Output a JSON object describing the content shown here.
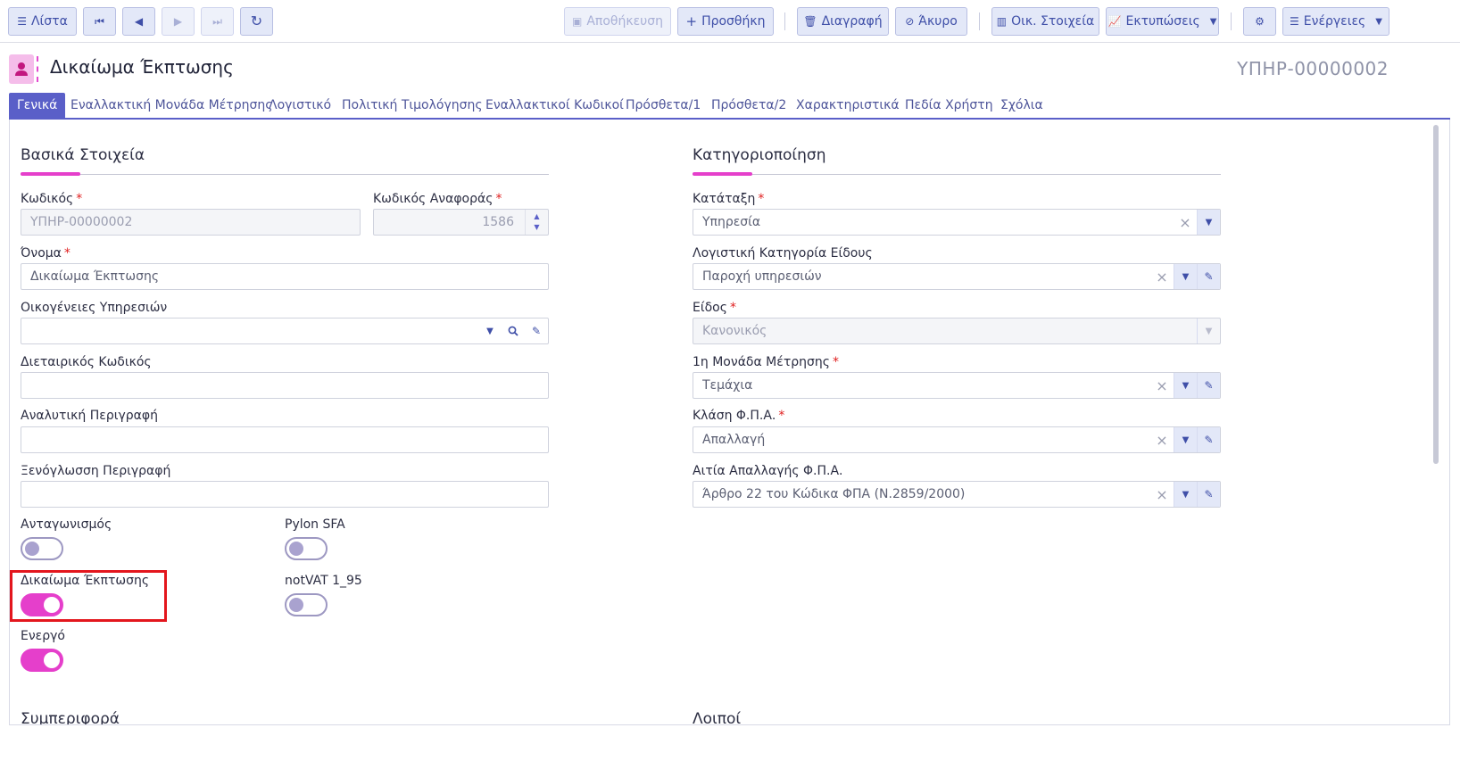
{
  "toolbar": {
    "list_label": "Λίστα",
    "save_label": "Αποθήκευση",
    "add_label": "Προσθήκη",
    "delete_label": "Διαγραφή",
    "cancel_label": "Άκυρο",
    "financial_label": "Οικ. Στοιχεία",
    "prints_label": "Εκτυπώσεις",
    "actions_label": "Ενέργειες"
  },
  "header": {
    "title": "Δικαίωμα Έκπτωσης",
    "record_code": "ΥΠΗΡ-00000002"
  },
  "tabs": [
    {
      "label": "Γενικά",
      "active": true
    },
    {
      "label": "Εναλλακτική Μονάδα Μέτρησης"
    },
    {
      "label": "Λογιστικό"
    },
    {
      "label": "Πολιτική Τιμολόγησης"
    },
    {
      "label": "Εναλλακτικοί Κωδικοί"
    },
    {
      "label": "Πρόσθετα/1"
    },
    {
      "label": "Πρόσθετα/2"
    },
    {
      "label": "Χαρακτηριστικά"
    },
    {
      "label": "Πεδία Χρήστη"
    },
    {
      "label": "Σχόλια"
    }
  ],
  "basic": {
    "section_title": "Βασικά Στοιχεία",
    "code_label": "Κωδικός",
    "code_value": "ΥΠΗΡ-00000002",
    "ref_code_label": "Κωδικός Αναφοράς",
    "ref_code_value": "1586",
    "name_label": "Όνομα",
    "name_value": "Δικαίωμα Έκπτωσης",
    "families_label": "Οικογένειες Υπηρεσιών",
    "families_value": "",
    "intercompany_label": "Διεταιρικός Κωδικός",
    "intercompany_value": "",
    "detailed_desc_label": "Αναλυτική Περιγραφή",
    "detailed_desc_value": "",
    "foreign_desc_label": "Ξενόγλωσση Περιγραφή",
    "foreign_desc_value": ""
  },
  "toggles": {
    "competition_label": "Ανταγωνισμός",
    "competition_on": false,
    "pylon_label": "Pylon SFA",
    "pylon_on": false,
    "discount_label": "Δικαίωμα Έκπτωσης",
    "discount_on": true,
    "notvat_label": "notVAT 1_95",
    "notvat_on": false,
    "active_label": "Ενεργό",
    "active_on": true
  },
  "classification": {
    "section_title": "Κατηγοριοποίηση",
    "category_label": "Κατάταξη",
    "category_value": "Υπηρεσία",
    "accounting_cat_label": "Λογιστική Κατηγορία Είδους",
    "accounting_cat_value": "Παροχή υπηρεσιών",
    "kind_label": "Είδος",
    "kind_value": "Κανονικός",
    "uom_label": "1η Μονάδα Μέτρησης",
    "uom_value": "Τεμάχια",
    "vat_class_label": "Κλάση Φ.Π.Α.",
    "vat_class_value": "Απαλλαγή",
    "vat_exempt_label": "Αιτία Απαλλαγής Φ.Π.Α.",
    "vat_exempt_value": "Άρθρο 22 του Κώδικα ΦΠΑ (Ν.2859/2000)"
  },
  "lower_sections": {
    "behavior_title": "Συμπεριφορά",
    "other_title": "Λοιποί"
  },
  "colors": {
    "accent": "#e53fcb",
    "primary": "#5a5fc8",
    "highlight_box": "#e3161d"
  }
}
